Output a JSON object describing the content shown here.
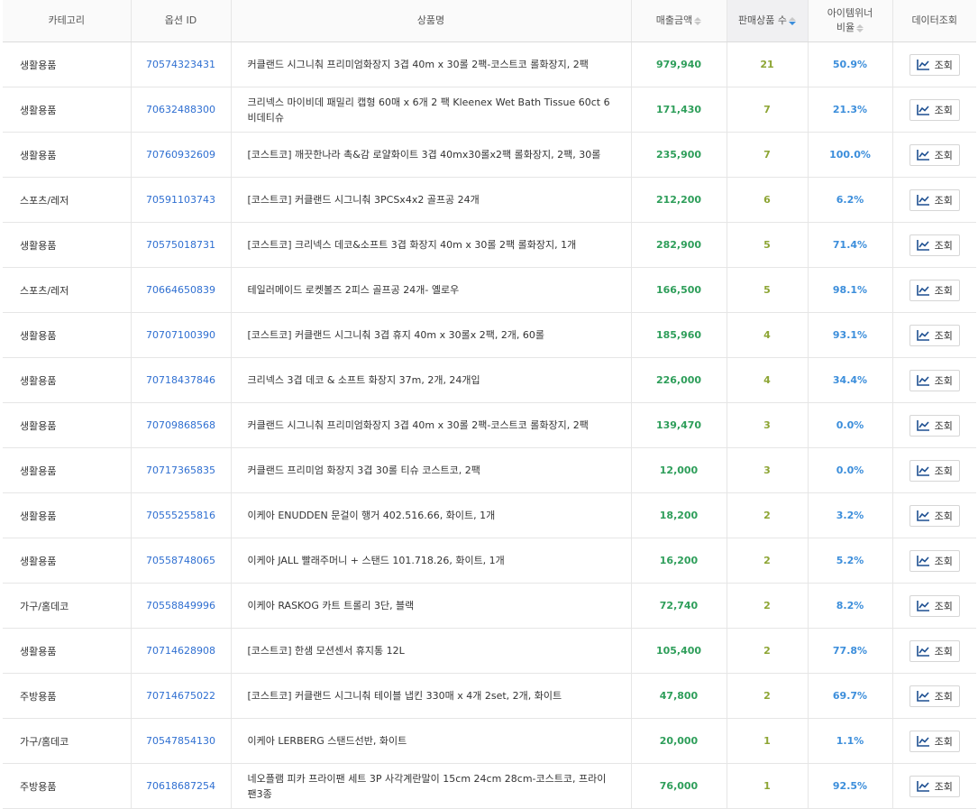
{
  "headers": {
    "category": "카테고리",
    "option_id": "옵션 ID",
    "product_name": "상품명",
    "sales": "매출금액",
    "sold_count": "판매상품 수",
    "winner_ratio_line1": "아이템위너",
    "winner_ratio_line2": "비율",
    "data_view": "데이터조회"
  },
  "sort": {
    "active_column": "sold_count",
    "direction": "desc"
  },
  "button_label": "조회",
  "icons": {
    "view_button": "line-chart-icon",
    "sort": "sort-arrows-icon"
  },
  "colors": {
    "link": "#2f6fd1",
    "sales": "#2e9e5a",
    "count": "#8da534",
    "ratio": "#3c8edb"
  },
  "rows": [
    {
      "category": "생활용품",
      "option_id": "70574323431",
      "name": "커클랜드 시그니춰 프리미엄화장지 3겹 40m x 30롤 2팩-코스트코 롤화장지, 2팩",
      "sales": "979,940",
      "count": "21",
      "ratio": "50.9%"
    },
    {
      "category": "생활용품",
      "option_id": "70632488300",
      "name": "크리넥스 마이비데 패밀리 캡형 60매 x 6개 2 팩 Kleenex Wet Bath Tissue 60ct 6 비데티슈",
      "sales": "171,430",
      "count": "7",
      "ratio": "21.3%"
    },
    {
      "category": "생활용품",
      "option_id": "70760932609",
      "name": "[코스트코] 깨끗한나라 촉&감 로얄화이트 3겹 40mx30롤x2팩 롤화장지, 2팩, 30롤",
      "sales": "235,900",
      "count": "7",
      "ratio": "100.0%"
    },
    {
      "category": "스포츠/레저",
      "option_id": "70591103743",
      "name": "[코스트코] 커클랜드 시그니춰 3PCSx4x2 골프공 24개",
      "sales": "212,200",
      "count": "6",
      "ratio": "6.2%"
    },
    {
      "category": "생활용품",
      "option_id": "70575018731",
      "name": "[코스트코] 크리넥스 데코&소프트 3겹 화장지 40m x 30롤 2팩 롤화장지, 1개",
      "sales": "282,900",
      "count": "5",
      "ratio": "71.4%"
    },
    {
      "category": "스포츠/레저",
      "option_id": "70664650839",
      "name": "테일러메이드 로켓볼즈 2피스 골프공 24개- 옐로우",
      "sales": "166,500",
      "count": "5",
      "ratio": "98.1%"
    },
    {
      "category": "생활용품",
      "option_id": "70707100390",
      "name": "[코스트코] 커클랜드 시그니춰 3겹 휴지 40m x 30롤x 2팩, 2개, 60롤",
      "sales": "185,960",
      "count": "4",
      "ratio": "93.1%"
    },
    {
      "category": "생활용품",
      "option_id": "70718437846",
      "name": "크리넥스 3겹 데코 & 소프트 화장지 37m, 2개, 24개입",
      "sales": "226,000",
      "count": "4",
      "ratio": "34.4%"
    },
    {
      "category": "생활용품",
      "option_id": "70709868568",
      "name": "커클랜드 시그니춰 프리미엄화장지 3겹 40m x 30롤 2팩-코스트코 롤화장지, 2팩",
      "sales": "139,470",
      "count": "3",
      "ratio": "0.0%"
    },
    {
      "category": "생활용품",
      "option_id": "70717365835",
      "name": "커클랜드 프리미엄 화장지 3겹 30롤 티슈 코스트코, 2팩",
      "sales": "12,000",
      "count": "3",
      "ratio": "0.0%"
    },
    {
      "category": "생활용품",
      "option_id": "70555255816",
      "name": "이케아 ENUDDEN 문걸이 행거 402.516.66, 화이트, 1개",
      "sales": "18,200",
      "count": "2",
      "ratio": "3.2%"
    },
    {
      "category": "생활용품",
      "option_id": "70558748065",
      "name": "이케아 JALL 빨래주머니 + 스탠드 101.718.26, 화이트, 1개",
      "sales": "16,200",
      "count": "2",
      "ratio": "5.2%"
    },
    {
      "category": "가구/홈데코",
      "option_id": "70558849996",
      "name": "이케아 RASKOG 카트 트롤리 3단, 블랙",
      "sales": "72,740",
      "count": "2",
      "ratio": "8.2%"
    },
    {
      "category": "생활용품",
      "option_id": "70714628908",
      "name": "[코스트코] 한샘 모션센서 휴지통 12L",
      "sales": "105,400",
      "count": "2",
      "ratio": "77.8%"
    },
    {
      "category": "주방용품",
      "option_id": "70714675022",
      "name": "[코스트코] 커클랜드 시그니춰 테이블 냅킨 330매 x 4개 2set, 2개, 화이트",
      "sales": "47,800",
      "count": "2",
      "ratio": "69.7%"
    },
    {
      "category": "가구/홈데코",
      "option_id": "70547854130",
      "name": "이케아 LERBERG 스탠드선반, 화이트",
      "sales": "20,000",
      "count": "1",
      "ratio": "1.1%"
    },
    {
      "category": "주방용품",
      "option_id": "70618687254",
      "name": "네오플램 피카 프라이팬 세트 3P 사각계란말이 15cm 24cm 28cm-코스트코, 프라이팬3종",
      "sales": "76,000",
      "count": "1",
      "ratio": "92.5%"
    }
  ]
}
